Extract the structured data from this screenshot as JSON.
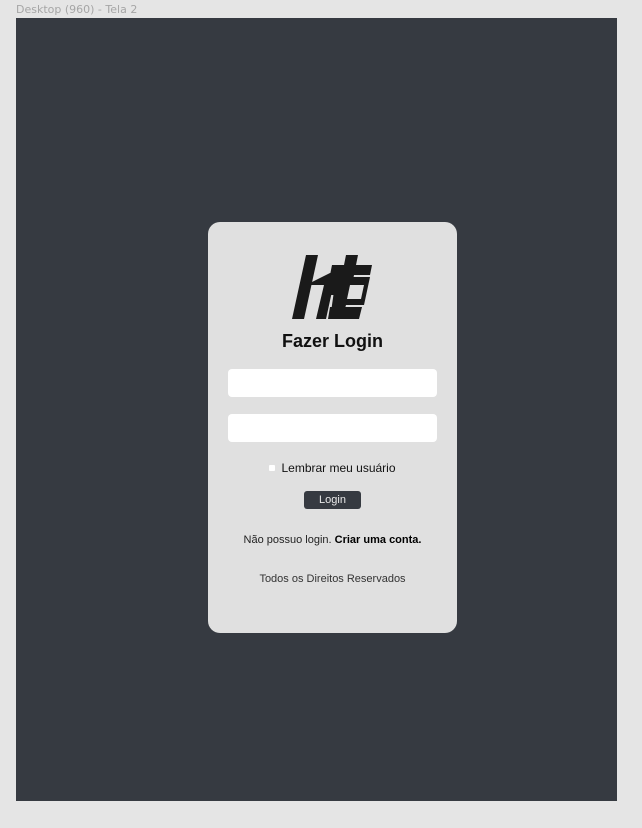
{
  "frame": {
    "label": "Desktop (960) - Tela 2"
  },
  "login": {
    "logo": "ht-logo",
    "title": "Fazer Login",
    "username_value": "",
    "password_value": "",
    "remember_label": "Lembrar meu usuário",
    "remember_checked": false,
    "button_label": "Login",
    "no_account_text": "Não possuo login.",
    "create_account_link": "Criar uma conta.",
    "footer": "Todos os Direitos Reservados"
  },
  "colors": {
    "page_bg": "#e5e5e5",
    "frame_bg": "#363a41",
    "card_bg": "#e0e0e0",
    "button_bg": "#363a41"
  }
}
